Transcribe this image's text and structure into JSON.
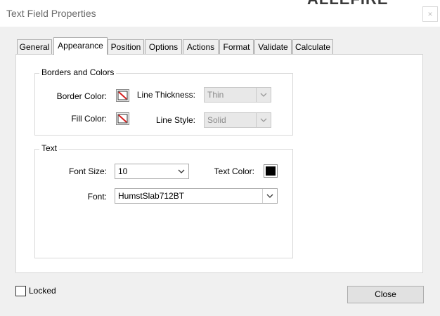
{
  "window": {
    "title": "Text Field Properties",
    "background_text": "ALLEFIRE",
    "close_glyph": "×"
  },
  "tabs": [
    {
      "label": "General"
    },
    {
      "label": "Appearance",
      "active": true
    },
    {
      "label": "Position"
    },
    {
      "label": "Options"
    },
    {
      "label": "Actions"
    },
    {
      "label": "Format"
    },
    {
      "label": "Validate"
    },
    {
      "label": "Calculate"
    }
  ],
  "borders_and_colors": {
    "title": "Borders and Colors",
    "border_color_label": "Border Color:",
    "fill_color_label": "Fill Color:",
    "line_thickness_label": "Line Thickness:",
    "line_thickness_value": "Thin",
    "line_style_label": "Line Style:",
    "line_style_value": "Solid"
  },
  "text_group": {
    "title": "Text",
    "font_size_label": "Font Size:",
    "font_size_value": "10",
    "text_color_label": "Text Color:",
    "text_color": "#000000",
    "font_label": "Font:",
    "font_value": "HumstSlab712BT"
  },
  "footer": {
    "locked_label": "Locked",
    "locked_checked": false,
    "close_button": "Close"
  },
  "icons": {
    "no_color_swatch": "no-color-icon",
    "dropdown_arrow": "chevron-down-icon"
  },
  "colors": {
    "no_color_stripe": "#d62020",
    "dialog_bg": "#f0f0f0",
    "panel_bg": "#ffffff"
  }
}
